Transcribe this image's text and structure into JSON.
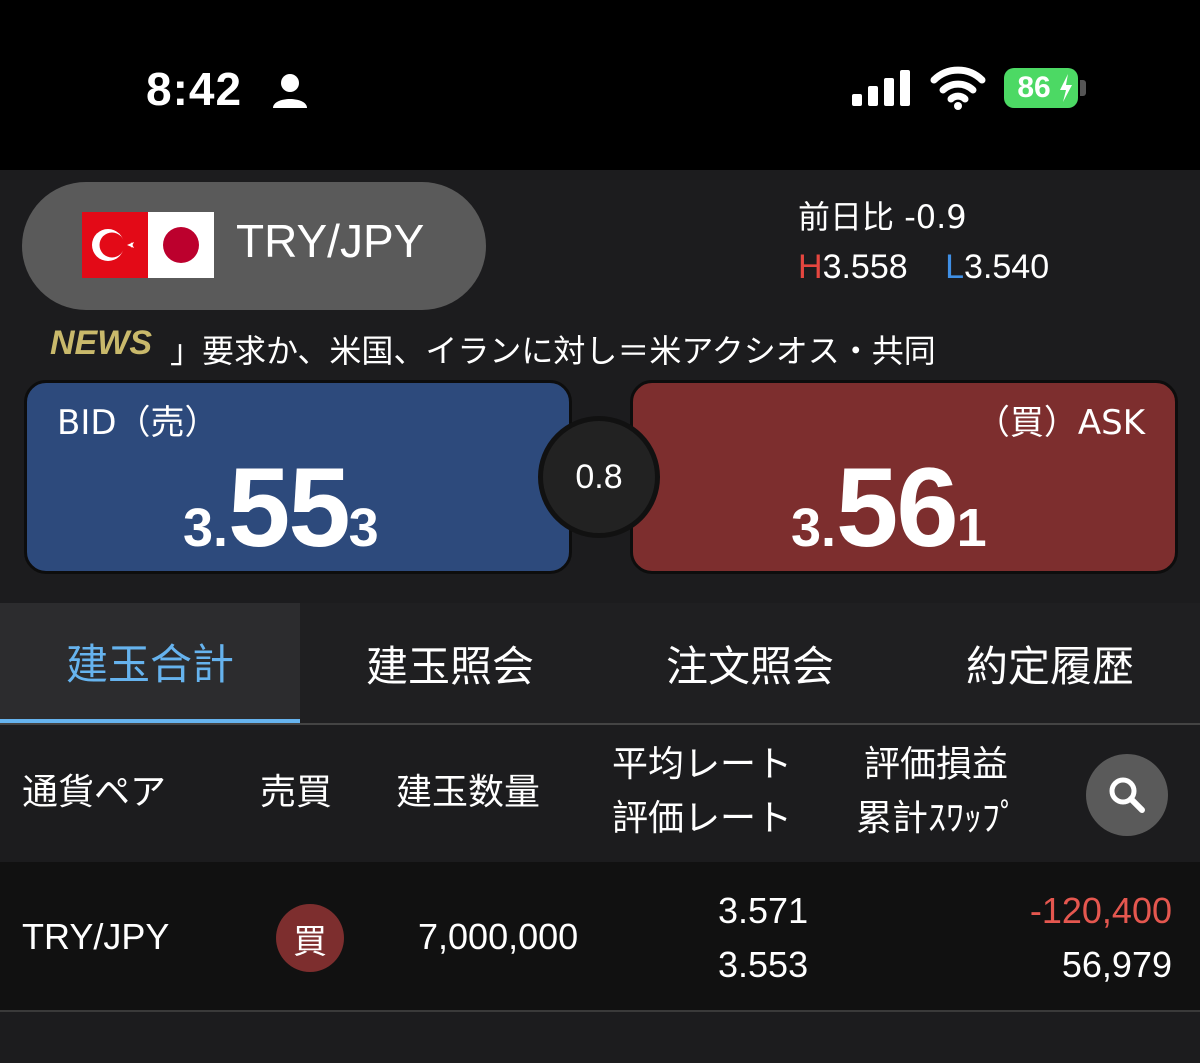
{
  "status": {
    "time": "8:42",
    "battery": "86"
  },
  "pair": {
    "name": "TRY/JPY"
  },
  "stats": {
    "change_label": "前日比",
    "change_value": "-0.9",
    "high_label": "H",
    "high_value": "3.558",
    "low_label": "L",
    "low_value": "3.540"
  },
  "news": {
    "label": "NEWS",
    "text": "」要求か、米国、イランに対し＝米アクシオス・共同"
  },
  "bid": {
    "label": "BID（売）",
    "prefix": "3.",
    "main": "55",
    "suffix": "3"
  },
  "ask": {
    "label": "（買）ASK",
    "prefix": "3.",
    "main": "56",
    "suffix": "1"
  },
  "spread": "0.8",
  "tabs": [
    {
      "label": "建玉合計"
    },
    {
      "label": "建玉照会"
    },
    {
      "label": "注文照会"
    },
    {
      "label": "約定履歴"
    }
  ],
  "table": {
    "headers": {
      "pair": "通貨ペア",
      "side": "売買",
      "qty": "建玉数量",
      "rate1": "平均レート",
      "rate2": "評価レート",
      "pl1": "評価損益",
      "pl2": "累計ｽﾜｯﾌﾟ"
    },
    "rows": [
      {
        "pair": "TRY/JPY",
        "side": "買",
        "qty": "7,000,000",
        "avg_rate": "3.571",
        "eval_rate": "3.553",
        "pl": "-120,400",
        "swap": "56,979"
      }
    ]
  },
  "colors": {
    "accent": "#66b3ee",
    "bid_bg": "#2d4a7c",
    "ask_bg": "#7d2e2e",
    "negative": "#e5574f",
    "news": "#c9b96b"
  }
}
